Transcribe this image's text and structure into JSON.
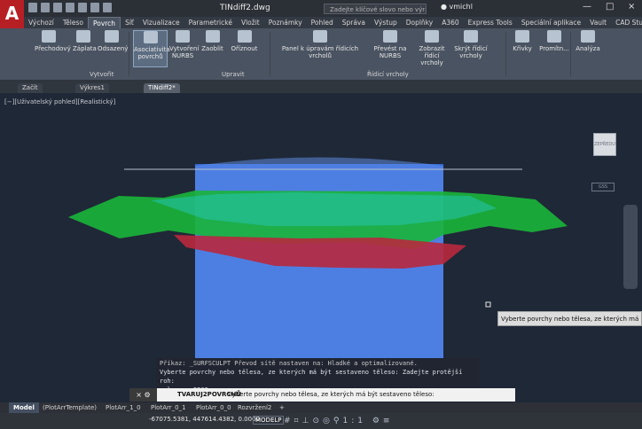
{
  "app": {
    "title": "TINdiff2.dwg",
    "search_placeholder": "Zadejte klíčové slovo nebo výraz",
    "user": "vmichl",
    "logo": "A"
  },
  "menu": {
    "items": [
      "Výchozí",
      "Těleso",
      "Povrch",
      "Síť",
      "Vizualizace",
      "Parametrické",
      "Vložit",
      "Poznámky",
      "Pohled",
      "Správa",
      "Výstup",
      "Doplňky",
      "A360",
      "Express Tools",
      "Speciální aplikace",
      "Vault",
      "CAD Studio"
    ],
    "active": "Povrch"
  },
  "ribbon": {
    "buttons": [
      "Přechodový",
      "Záplata",
      "Odsazený",
      "Asociativita povrchů",
      "Vytvoření NURBS",
      "Zaoblit",
      "Oříznout",
      "Panel k úpravám řídicích vrcholů",
      "Převést na NURBS",
      "Zobrazit řídicí vrcholy",
      "Skrýt řídicí vrcholy",
      "Křivky",
      "Promítn...",
      "Analýza"
    ],
    "panels": [
      "Vytvořit",
      "Upravit",
      "Řídicí vrcholy"
    ]
  },
  "doc_tabs": [
    "Začít",
    "Výkres1",
    "TINdiff2*"
  ],
  "viewport": {
    "label": "[−][Uživatelský pohled][Realistický]",
    "viewcube": "ZEPŘEDU",
    "wcs": "GSS",
    "tooltip": "Vyberte povrchy nebo tělesa, ze kterých má být ses"
  },
  "command": {
    "history": [
      "Příkaz: _SURFSCULPT Převod sítě nastaven na: Hladké a optimalizované.",
      "Vyberte povrchy nebo tělesa, ze kterých má být sestaveno těleso: Zadejte protější roh:",
      "nalezeno 2203"
    ],
    "prefix": "TVARUJ2POVRCHŮ",
    "text": "Vyberte povrchy nebo tělesa, ze kterých má být sestaveno těleso:"
  },
  "layout_tabs": [
    "Model",
    "(PlotArrTemplate)",
    "PlotArr_1_0",
    "PlotArr_0_1",
    "PlotArr_0_0",
    "Rozvržení2"
  ],
  "status": {
    "coords": "-67075.5381, 447614.4382, 0.0000",
    "model": "MODELP",
    "scale": "1:1"
  },
  "colors": {
    "accent": "#b61f24",
    "viewport": "#1f2837",
    "surface_blue": "#3d73ff",
    "surface_green": "#18b338",
    "surface_red": "#b7273b"
  }
}
